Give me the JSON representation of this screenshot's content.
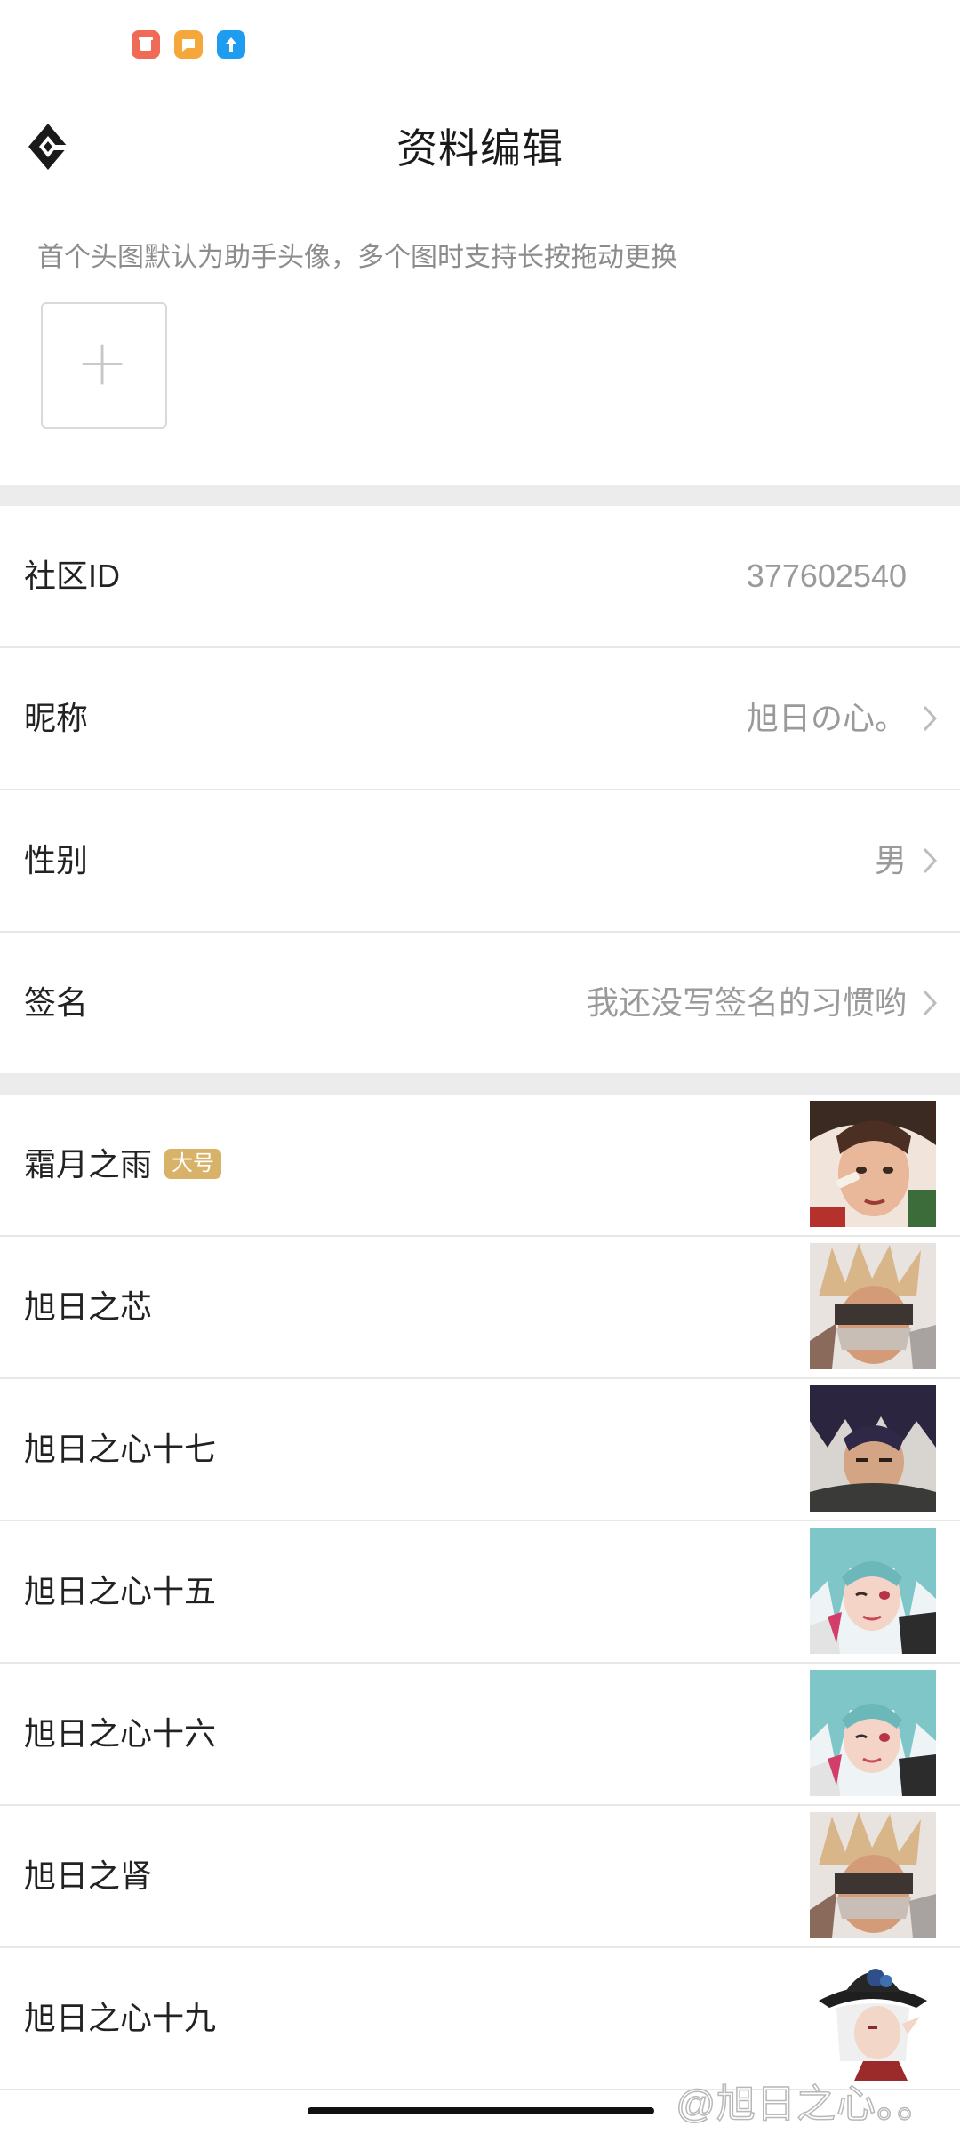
{
  "status_bar": {
    "app_icons": [
      {
        "name": "red-app-icon",
        "color": "#ef6b57"
      },
      {
        "name": "orange-app-icon",
        "color": "#f6a73a"
      },
      {
        "name": "blue-app-icon",
        "color": "#1e9cf0"
      }
    ]
  },
  "header": {
    "title": "资料编辑",
    "back_icon": "diamond-back-icon"
  },
  "avatar_section": {
    "hint": "首个头图默认为助手头像，多个图时支持长按拖动更换",
    "add_icon": "plus-icon"
  },
  "profile": {
    "community_id": {
      "label": "社区ID",
      "value": "377602540"
    },
    "nickname": {
      "label": "昵称",
      "value": "旭日の心。"
    },
    "gender": {
      "label": "性别",
      "value": "男"
    },
    "signature": {
      "label": "签名",
      "value": "我还没写签名的习惯哟"
    }
  },
  "accounts": [
    {
      "name": "霜月之雨",
      "badge": "大号",
      "avatar": "portrait-girl-bandage"
    },
    {
      "name": "旭日之芯",
      "badge": "",
      "avatar": "portrait-spiky-blond-mask"
    },
    {
      "name": "旭日之心十七",
      "badge": "",
      "avatar": "portrait-dark-hair-swordsman"
    },
    {
      "name": "旭日之心十五",
      "badge": "",
      "avatar": "portrait-teal-hair-girl-wink"
    },
    {
      "name": "旭日之心十六",
      "badge": "",
      "avatar": "portrait-teal-hair-girl-wink"
    },
    {
      "name": "旭日之肾",
      "badge": "",
      "avatar": "portrait-spiky-blond-mask"
    },
    {
      "name": "旭日之心十九",
      "badge": "",
      "avatar": "portrait-white-hair-hat"
    }
  ],
  "watermark": "@旭日之心。。",
  "colors": {
    "background": "#ffffff",
    "section_gap": "#ececec",
    "badge": "#d9b26a",
    "secondary_text": "#9a9a9a"
  }
}
